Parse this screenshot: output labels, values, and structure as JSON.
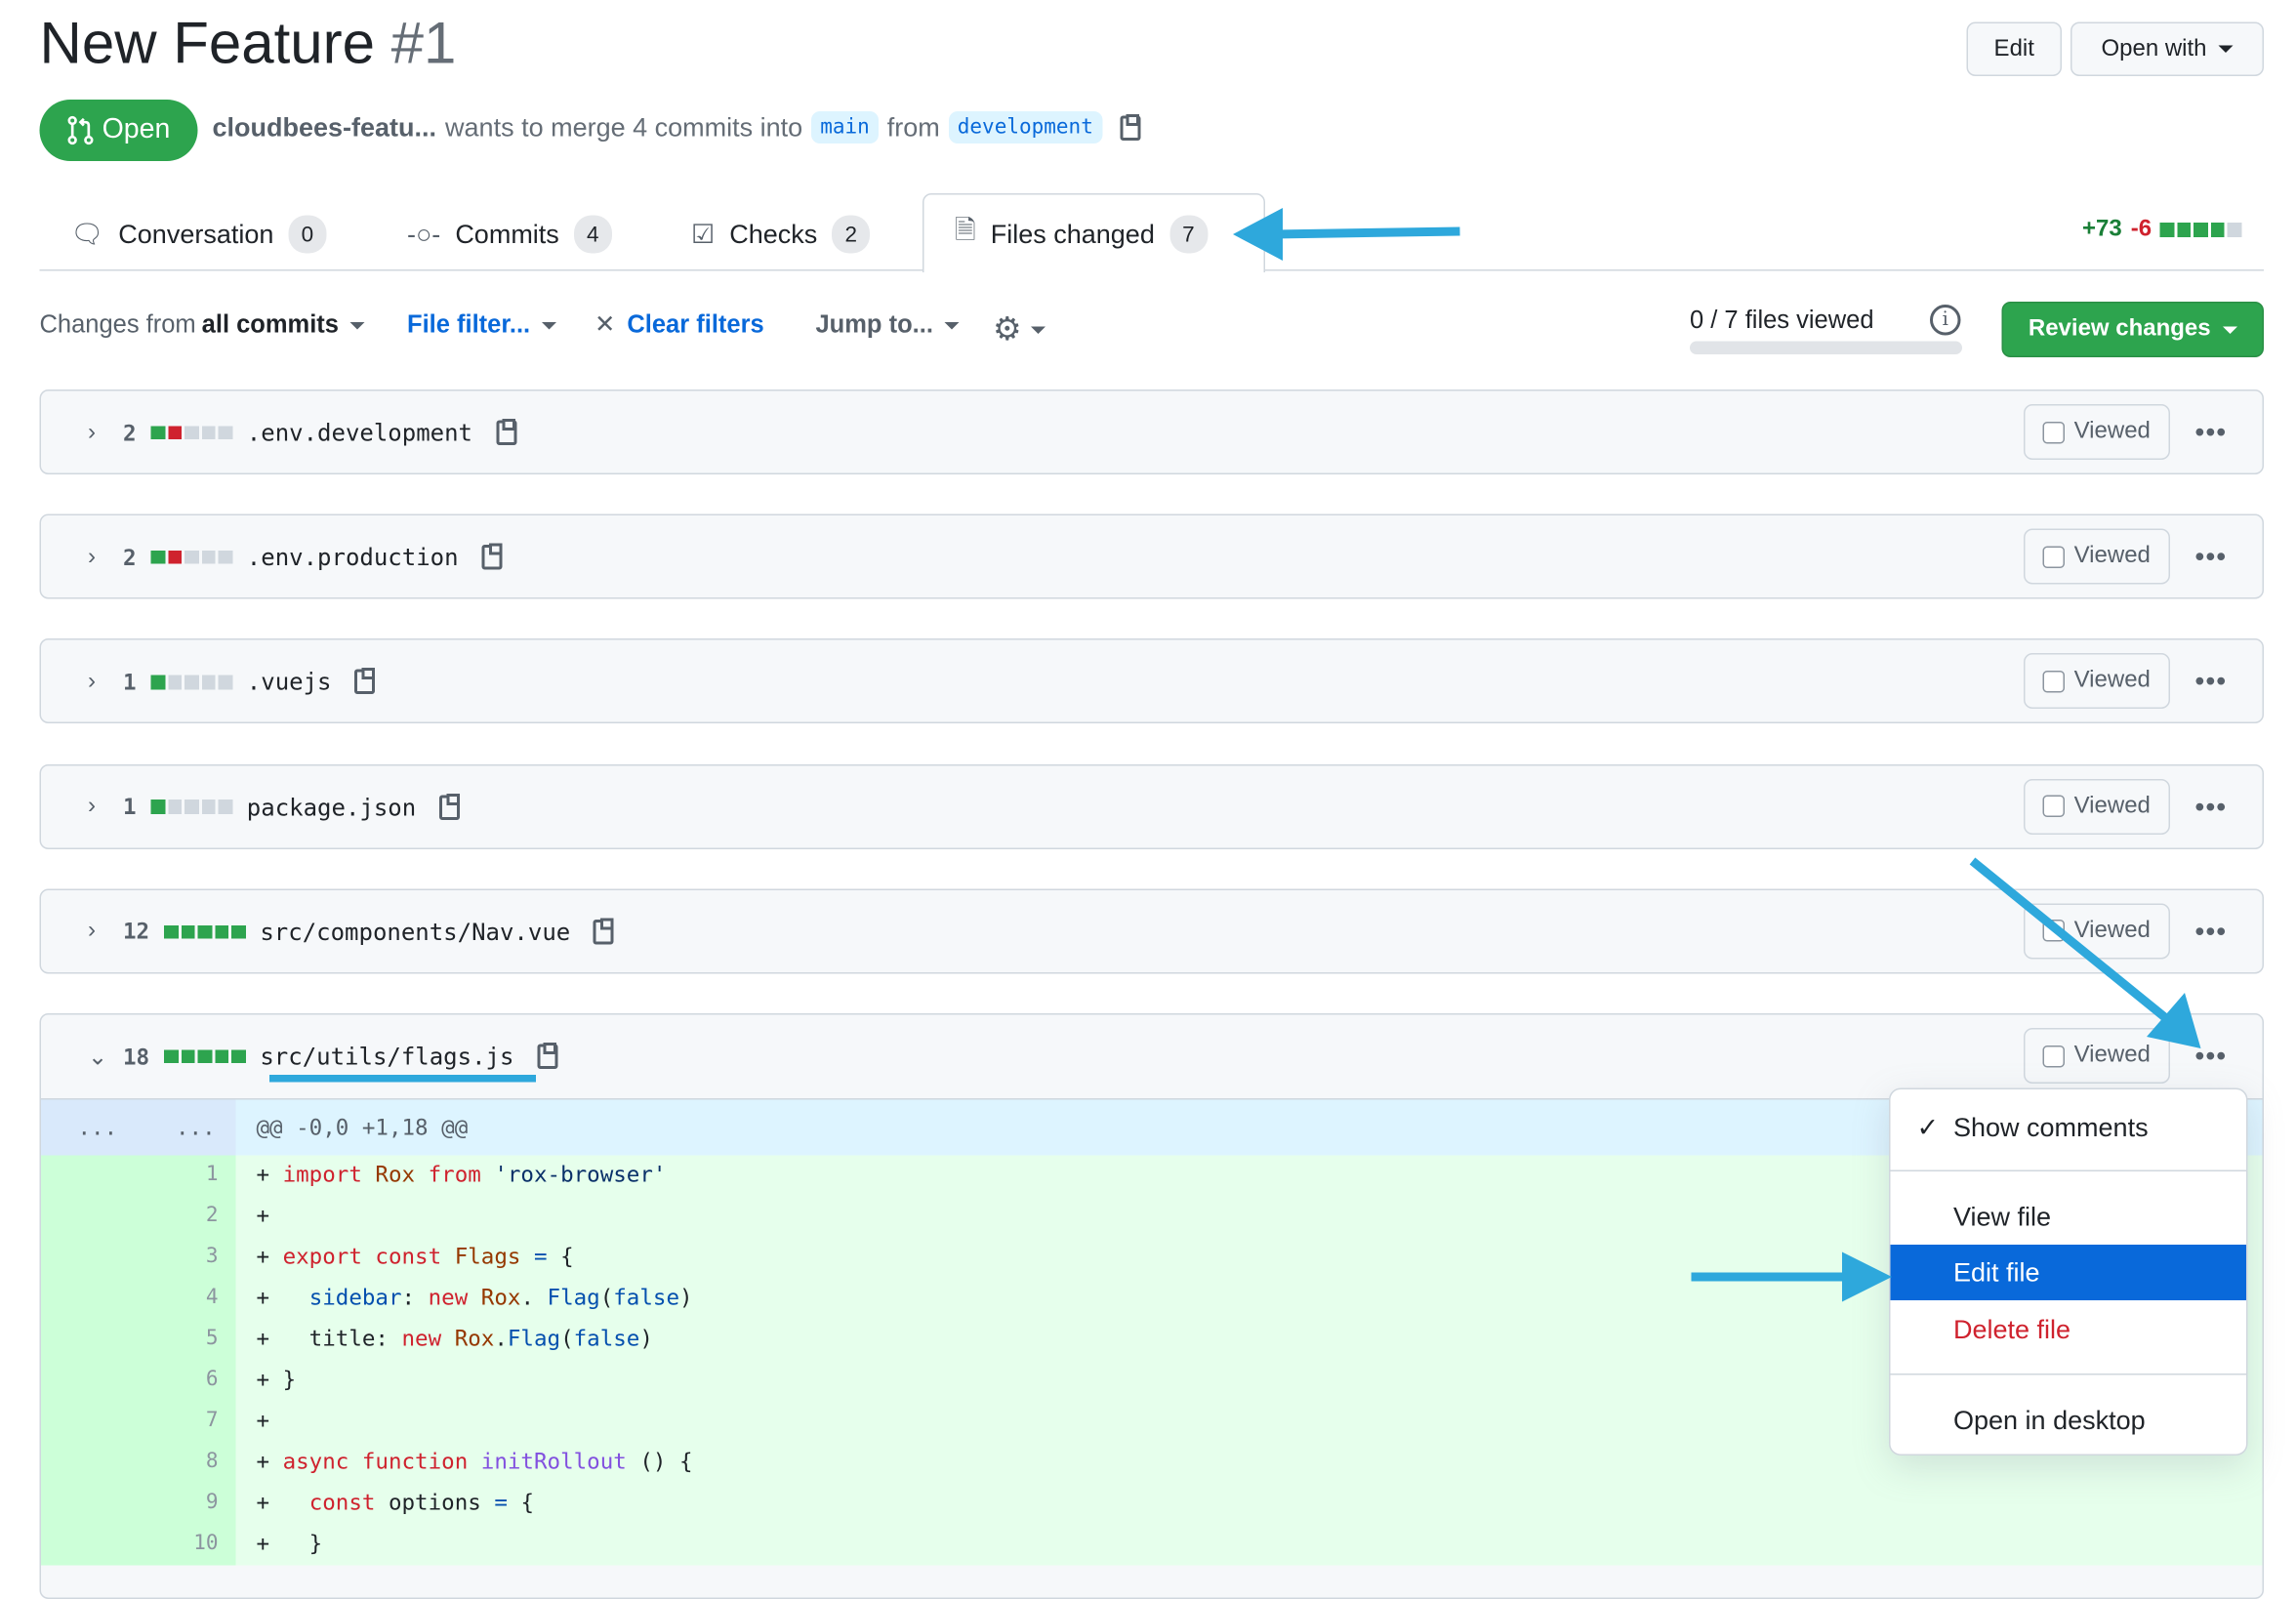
{
  "header": {
    "title": "New Feature",
    "number": "#1",
    "edit_label": "Edit",
    "open_with_label": "Open with"
  },
  "status": {
    "label": "Open",
    "color": "#2da44e"
  },
  "meta": {
    "author": "cloudbees-featu...",
    "text": "wants to merge 4 commits into",
    "base": "main",
    "from": "from",
    "head": "development"
  },
  "tabs": [
    {
      "label": "Conversation",
      "count": "0"
    },
    {
      "label": "Commits",
      "count": "4"
    },
    {
      "label": "Checks",
      "count": "2"
    },
    {
      "label": "Files changed",
      "count": "7",
      "active": true
    }
  ],
  "diffstat": {
    "additions": "+73",
    "deletions": "-6"
  },
  "toolbar": {
    "changes_from": "Changes from",
    "all_commits": "all commits",
    "file_filter": "File filter...",
    "clear_filters": "Clear filters",
    "jump_to": "Jump to...",
    "files_viewed": "0 / 7 files viewed",
    "files_viewed_progress": 0,
    "review_changes": "Review changes"
  },
  "files": [
    {
      "count": "2",
      "name": ".env.development",
      "blocks": [
        "g",
        "r",
        "n",
        "n",
        "n"
      ],
      "viewed": "Viewed"
    },
    {
      "count": "2",
      "name": ".env.production",
      "blocks": [
        "g",
        "r",
        "n",
        "n",
        "n"
      ],
      "viewed": "Viewed"
    },
    {
      "count": "1",
      "name": ".vuejs",
      "blocks": [
        "g",
        "n",
        "n",
        "n",
        "n"
      ],
      "viewed": "Viewed"
    },
    {
      "count": "1",
      "name": "package.json",
      "blocks": [
        "g",
        "n",
        "n",
        "n",
        "n"
      ],
      "viewed": "Viewed"
    },
    {
      "count": "12",
      "name": "src/components/Nav.vue",
      "blocks": [
        "g",
        "g",
        "g",
        "g",
        "g"
      ],
      "viewed": "Viewed"
    },
    {
      "count": "18",
      "name": "src/utils/flags.js",
      "blocks": [
        "g",
        "g",
        "g",
        "g",
        "g"
      ],
      "viewed": "Viewed",
      "expanded": true
    }
  ],
  "diff": {
    "hunk_left": "...",
    "hunk_right": "...",
    "hunk": "@@ -0,0 +1,18 @@",
    "lines": [
      {
        "n": "1",
        "tokens": [
          [
            "",
            "+ "
          ],
          [
            "kw",
            "import "
          ],
          [
            "en",
            "Rox "
          ],
          [
            "kw",
            "from "
          ],
          [
            "st",
            "'rox-browser'"
          ]
        ]
      },
      {
        "n": "2",
        "tokens": [
          [
            "",
            "+"
          ]
        ]
      },
      {
        "n": "3",
        "tokens": [
          [
            "",
            "+ "
          ],
          [
            "kw",
            "export const "
          ],
          [
            "en",
            "Flags "
          ],
          [
            "c1",
            "= "
          ],
          [
            "",
            "{"
          ]
        ]
      },
      {
        "n": "4",
        "tokens": [
          [
            "",
            "+   "
          ],
          [
            "c1",
            "sidebar"
          ],
          [
            "",
            ": "
          ],
          [
            "kw",
            "new "
          ],
          [
            "en",
            "Rox"
          ],
          [
            "",
            ". "
          ],
          [
            "c1",
            "Flag"
          ],
          [
            "",
            "("
          ],
          [
            "c1",
            "false"
          ],
          [
            "",
            ")"
          ]
        ]
      },
      {
        "n": "5",
        "tokens": [
          [
            "",
            "+   title: "
          ],
          [
            "kw",
            "new "
          ],
          [
            "en",
            "Rox"
          ],
          [
            "",
            "."
          ],
          [
            "c1",
            "Flag"
          ],
          [
            "",
            "("
          ],
          [
            "c1",
            "false"
          ],
          [
            "",
            ")"
          ]
        ]
      },
      {
        "n": "6",
        "tokens": [
          [
            "",
            "+ }"
          ]
        ]
      },
      {
        "n": "7",
        "tokens": [
          [
            "",
            "+"
          ]
        ]
      },
      {
        "n": "8",
        "tokens": [
          [
            "",
            "+ "
          ],
          [
            "kw",
            "async function "
          ],
          [
            "fn",
            "initRollout"
          ],
          [
            "",
            " () {"
          ]
        ]
      },
      {
        "n": "9",
        "tokens": [
          [
            "",
            "+   "
          ],
          [
            "kw",
            "const "
          ],
          [
            "",
            "options "
          ],
          [
            "c1",
            "= "
          ],
          [
            "",
            "{"
          ]
        ]
      },
      {
        "n": "10",
        "tokens": [
          [
            "",
            "+   }"
          ]
        ]
      }
    ]
  },
  "menu": {
    "items": [
      "Show comments",
      "View file",
      "Edit file",
      "Delete file",
      "Open in desktop"
    ],
    "highlighted": "Edit file"
  },
  "colors": {
    "accent": "#0969da",
    "arrow": "#2ea8dc",
    "added": "#e6ffec",
    "danger": "#cf222e"
  }
}
